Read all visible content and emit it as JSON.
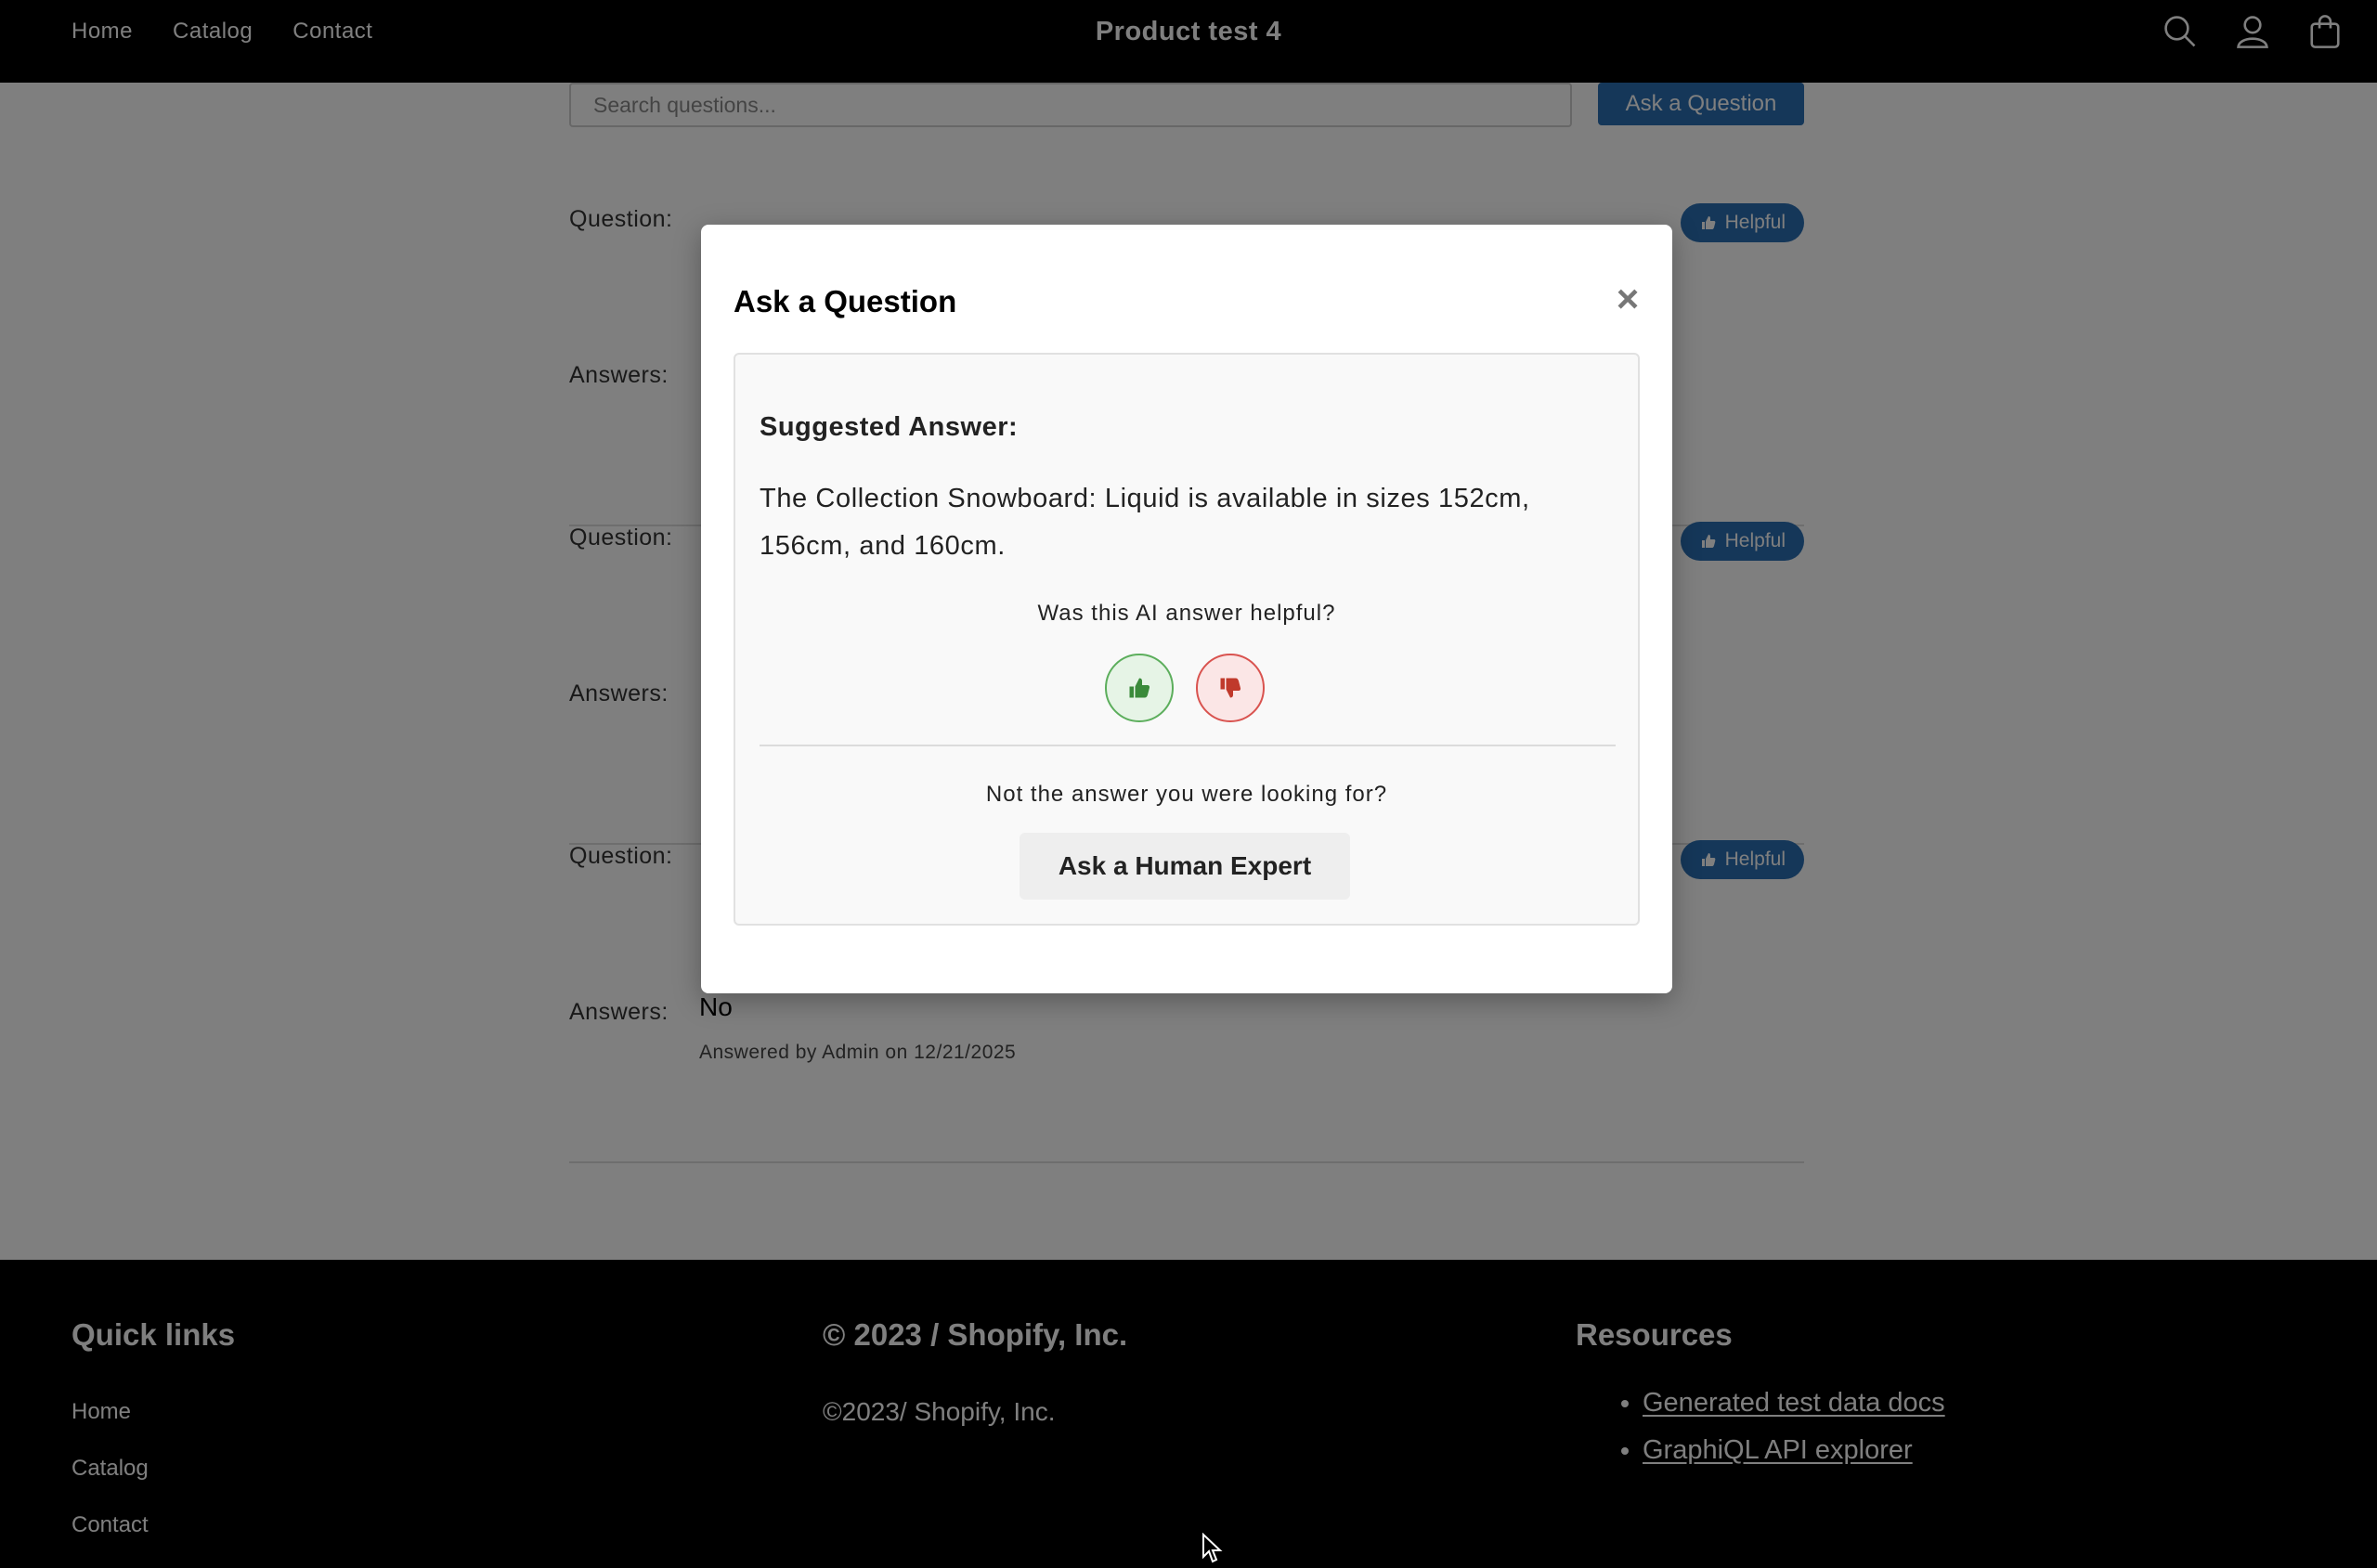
{
  "header": {
    "nav": [
      "Home",
      "Catalog",
      "Contact"
    ],
    "title": "Product test 4",
    "icons": [
      "search-icon",
      "account-icon",
      "cart-icon"
    ]
  },
  "qa_section": {
    "search_placeholder": "Search questions...",
    "ask_button": "Ask a Question",
    "question_label": "Question:",
    "answers_label": "Answers:",
    "helpful_label": "Helpful",
    "items": [
      {
        "answer": "",
        "meta": ""
      },
      {
        "answer": "",
        "meta": ""
      },
      {
        "answer": "No",
        "meta": "Answered by Admin on 12/21/2025"
      }
    ]
  },
  "modal": {
    "title": "Ask a Question",
    "close": "×",
    "suggested_label": "Suggested Answer:",
    "suggested_text": "The Collection Snowboard: Liquid is available in sizes 152cm, 156cm, and 160cm.",
    "feedback_question": "Was this AI answer helpful?",
    "not_answer_text": "Not the answer you were looking for?",
    "human_button": "Ask a Human Expert"
  },
  "footer": {
    "quick_links_title": "Quick links",
    "quick_links": [
      "Home",
      "Catalog",
      "Contact"
    ],
    "copyright_title": "© 2023 / Shopify, Inc.",
    "copyright_text": "©2023/ Shopify, Inc.",
    "resources_title": "Resources",
    "resources": [
      "Generated test data docs",
      "GraphiQL API explorer"
    ]
  },
  "colors": {
    "accent": "#2b6fb3",
    "thumbs_up": "#3a8a3a",
    "thumbs_down": "#c0392b"
  }
}
